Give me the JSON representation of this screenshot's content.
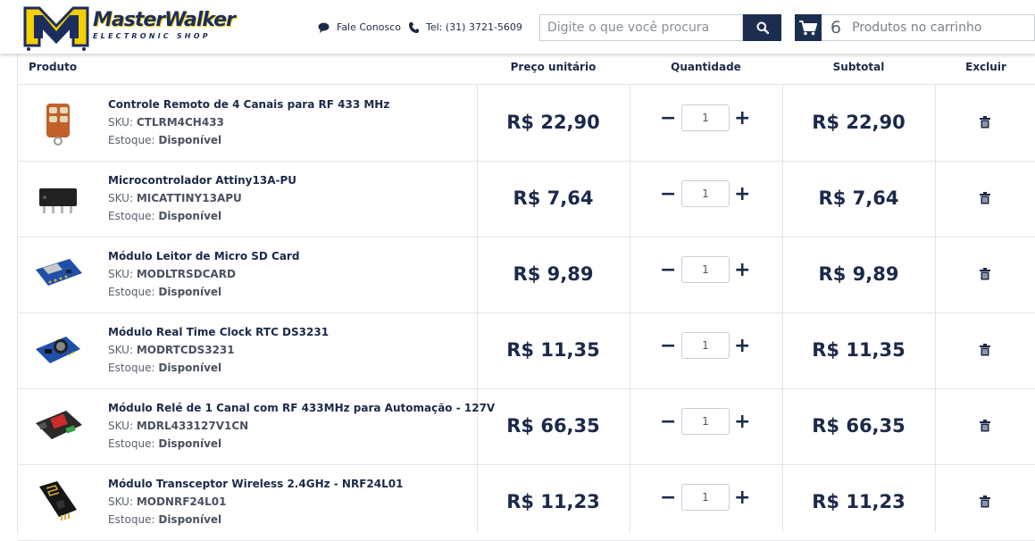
{
  "header": {
    "logo_title": "MasterWalker",
    "logo_subtitle": "ELECTRONIC SHOP",
    "contact_label": "Fale Conosco",
    "phone_label": "Tel: (31) 3721-5609",
    "search_placeholder": "Digite o que você procura",
    "cart_count": "6",
    "cart_label": "Produtos no carrinho"
  },
  "table": {
    "columns": [
      "Produto",
      "Preço unitário",
      "Quantidade",
      "Subtotal",
      "Excluir"
    ],
    "sku_prefix": "SKU:",
    "stock_prefix": "Estoque:",
    "rows": [
      {
        "name": "Controle Remoto de 4 Canais para RF 433 MHz",
        "sku": "CTLRM4CH433",
        "stock": "Disponível",
        "price": "R$ 22,90",
        "qty": "1",
        "subtotal": "R$ 22,90"
      },
      {
        "name": "Microcontrolador Attiny13A-PU",
        "sku": "MICATTINY13APU",
        "stock": "Disponível",
        "price": "R$ 7,64",
        "qty": "1",
        "subtotal": "R$ 7,64"
      },
      {
        "name": "Módulo Leitor de Micro SD Card",
        "sku": "MODLTRSDCARD",
        "stock": "Disponível",
        "price": "R$ 9,89",
        "qty": "1",
        "subtotal": "R$ 9,89"
      },
      {
        "name": "Módulo Real Time Clock RTC DS3231",
        "sku": "MODRTCDS3231",
        "stock": "Disponível",
        "price": "R$ 11,35",
        "qty": "1",
        "subtotal": "R$ 11,35"
      },
      {
        "name": "Módulo Relé de 1 Canal com RF 433MHz para Automação - 127V",
        "sku": "MDRL433127V1CN",
        "stock": "Disponível",
        "price": "R$ 66,35",
        "qty": "1",
        "subtotal": "R$ 66,35"
      },
      {
        "name": "Módulo Transceptor Wireless 2.4GHz - NRF24L01",
        "sku": "MODNRF24L01",
        "stock": "Disponível",
        "price": "R$ 11,23",
        "qty": "1",
        "subtotal": "R$ 11,23"
      }
    ],
    "qty_minus": "−",
    "qty_plus": "+"
  },
  "colors": {
    "navy": "#1c2d4f",
    "logo_yellow": "#f4d000",
    "border": "#e1e4e8"
  }
}
